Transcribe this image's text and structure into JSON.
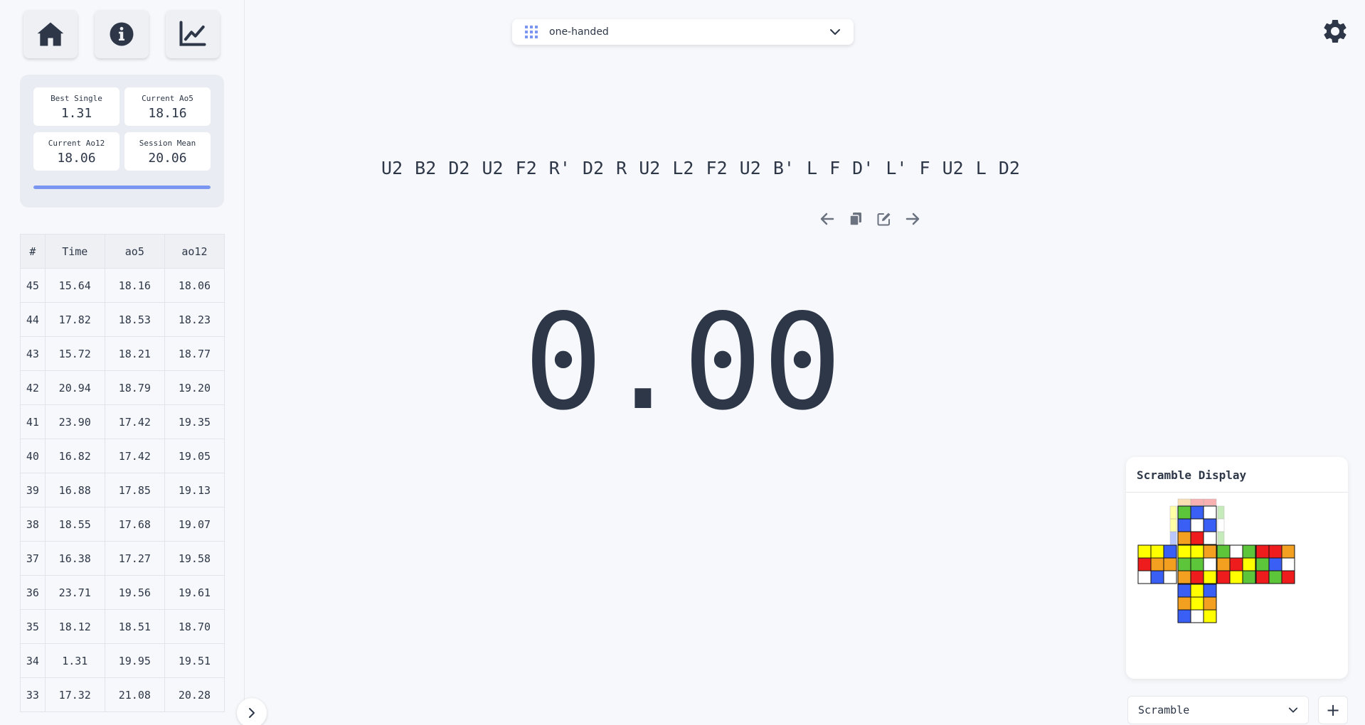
{
  "nav": {
    "home_icon": "home-icon",
    "info_icon": "info-icon",
    "stats_icon": "chart-line-icon"
  },
  "stats": {
    "best_single": {
      "label": "Best Single",
      "value": "1.31"
    },
    "current_ao5": {
      "label": "Current Ao5",
      "value": "18.16"
    },
    "current_ao12": {
      "label": "Current Ao12",
      "value": "18.06"
    },
    "session_mean": {
      "label": "Session Mean",
      "value": "20.06"
    },
    "progress_fraction": 1.0
  },
  "times_table": {
    "headers": [
      "#",
      "Time",
      "ao5",
      "ao12"
    ],
    "rows": [
      [
        "45",
        "15.64",
        "18.16",
        "18.06"
      ],
      [
        "44",
        "17.82",
        "18.53",
        "18.23"
      ],
      [
        "43",
        "15.72",
        "18.21",
        "18.77"
      ],
      [
        "42",
        "20.94",
        "18.79",
        "19.20"
      ],
      [
        "41",
        "23.90",
        "17.42",
        "19.35"
      ],
      [
        "40",
        "16.82",
        "17.42",
        "19.05"
      ],
      [
        "39",
        "16.88",
        "17.85",
        "19.13"
      ],
      [
        "38",
        "18.55",
        "17.68",
        "19.07"
      ],
      [
        "37",
        "16.38",
        "17.27",
        "19.58"
      ],
      [
        "36",
        "23.71",
        "19.56",
        "19.61"
      ],
      [
        "35",
        "18.12",
        "18.51",
        "18.70"
      ],
      [
        "34",
        "1.31",
        "19.95",
        "19.51"
      ],
      [
        "33",
        "17.32",
        "21.08",
        "20.28"
      ]
    ]
  },
  "session": {
    "selected": "one-handed"
  },
  "scramble": {
    "text": "U2 B2 D2 U2 F2 R' D2 R U2 L2 F2 U2 B' L F D' L' F U2 L D2"
  },
  "timer": {
    "display": "0.00"
  },
  "scramble_display": {
    "title": "Scramble Display",
    "colors": {
      "W": "#ffffff",
      "Y": "#ffff00",
      "R": "#ee1c1c",
      "O": "#f3a021",
      "G": "#5cc53a",
      "B": "#3a5ff5"
    },
    "faces": {
      "U": [
        "G",
        "B",
        "W",
        "B",
        "W",
        "B",
        "O",
        "R",
        "W"
      ],
      "L": [
        "Y",
        "Y",
        "B",
        "R",
        "O",
        "O",
        "W",
        "B",
        "W"
      ],
      "F": [
        "Y",
        "Y",
        "O",
        "G",
        "G",
        "W",
        "O",
        "R",
        "Y"
      ],
      "R": [
        "G",
        "W",
        "G",
        "O",
        "R",
        "Y",
        "R",
        "Y",
        "G"
      ],
      "B": [
        "R",
        "R",
        "O",
        "G",
        "B",
        "W",
        "R",
        "G",
        "R"
      ],
      "D": [
        "B",
        "Y",
        "B",
        "O",
        "Y",
        "O",
        "B",
        "W",
        "Y"
      ]
    }
  },
  "bottom_tool": {
    "selected": "Scramble",
    "add_label": "+"
  }
}
